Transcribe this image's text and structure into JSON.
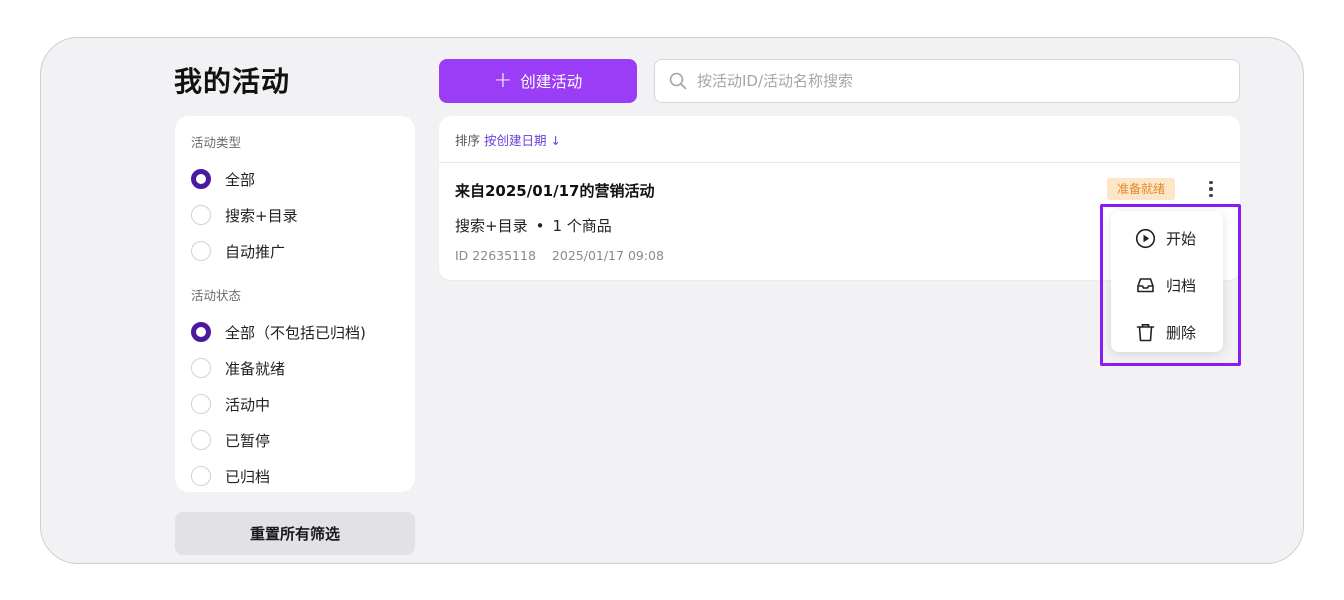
{
  "page": {
    "title": "我的活动"
  },
  "filters": {
    "type_label": "活动类型",
    "type_options": [
      {
        "label": "全部",
        "checked": true
      },
      {
        "label": "搜索+目录",
        "checked": false
      },
      {
        "label": "自动推广",
        "checked": false
      }
    ],
    "status_label": "活动状态",
    "status_options": [
      {
        "label": "全部（不包括已归档)",
        "checked": true
      },
      {
        "label": "准备就绪",
        "checked": false
      },
      {
        "label": "活动中",
        "checked": false
      },
      {
        "label": "已暂停",
        "checked": false
      },
      {
        "label": "已归档",
        "checked": false
      }
    ],
    "reset_label": "重置所有筛选"
  },
  "toolbar": {
    "create_label": "创建活动",
    "create_icon": "plus-icon",
    "search_placeholder": "按活动ID/活动名称搜索",
    "search_value": ""
  },
  "list": {
    "sort_prefix": "排序",
    "sort_value": "按创建日期 ↓",
    "items": [
      {
        "title": "来自2025/01/17的营销活动",
        "type": "搜索+目录",
        "separator": "•",
        "products": "1 个商品",
        "id_text": "ID 22635118",
        "date": "2025/01/17 09:08",
        "status": "准备就绪"
      }
    ]
  },
  "context_menu": {
    "items": [
      {
        "label": "开始",
        "icon": "play-icon"
      },
      {
        "label": "归档",
        "icon": "archive-icon"
      },
      {
        "label": "删除",
        "icon": "trash-icon"
      }
    ]
  },
  "colors": {
    "accent": "#9b3df6",
    "radio_checked": "#4a1a9e",
    "badge_bg": "#fde6c8",
    "badge_text": "#e08a2a",
    "highlight": "#8a1cf0"
  }
}
